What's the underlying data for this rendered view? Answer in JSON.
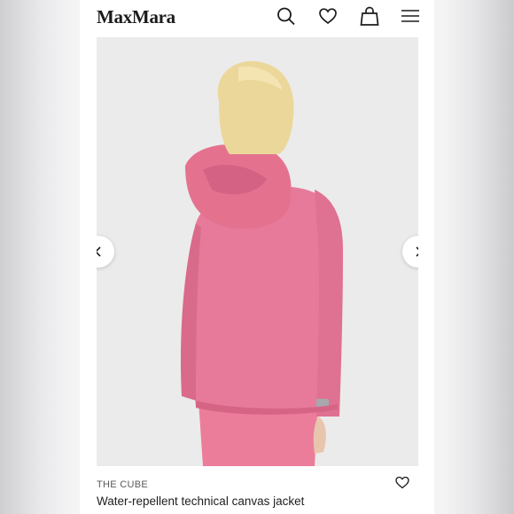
{
  "header": {
    "logo": "MaxMara",
    "icons": [
      "search-icon",
      "heart-icon",
      "bag-icon",
      "menu-icon"
    ]
  },
  "gallery": {
    "prev_icon": "chevron-left-icon",
    "next_icon": "chevron-right-icon",
    "image_subject": "model wearing pink hooded jacket, back view"
  },
  "product": {
    "brand": "THE CUBE",
    "title": "Water-repellent technical canvas jacket",
    "wishlist_icon": "heart-icon"
  },
  "colors": {
    "jacket": "#e77a9a",
    "background": "#ebebeb",
    "text": "#1e1e1e"
  }
}
